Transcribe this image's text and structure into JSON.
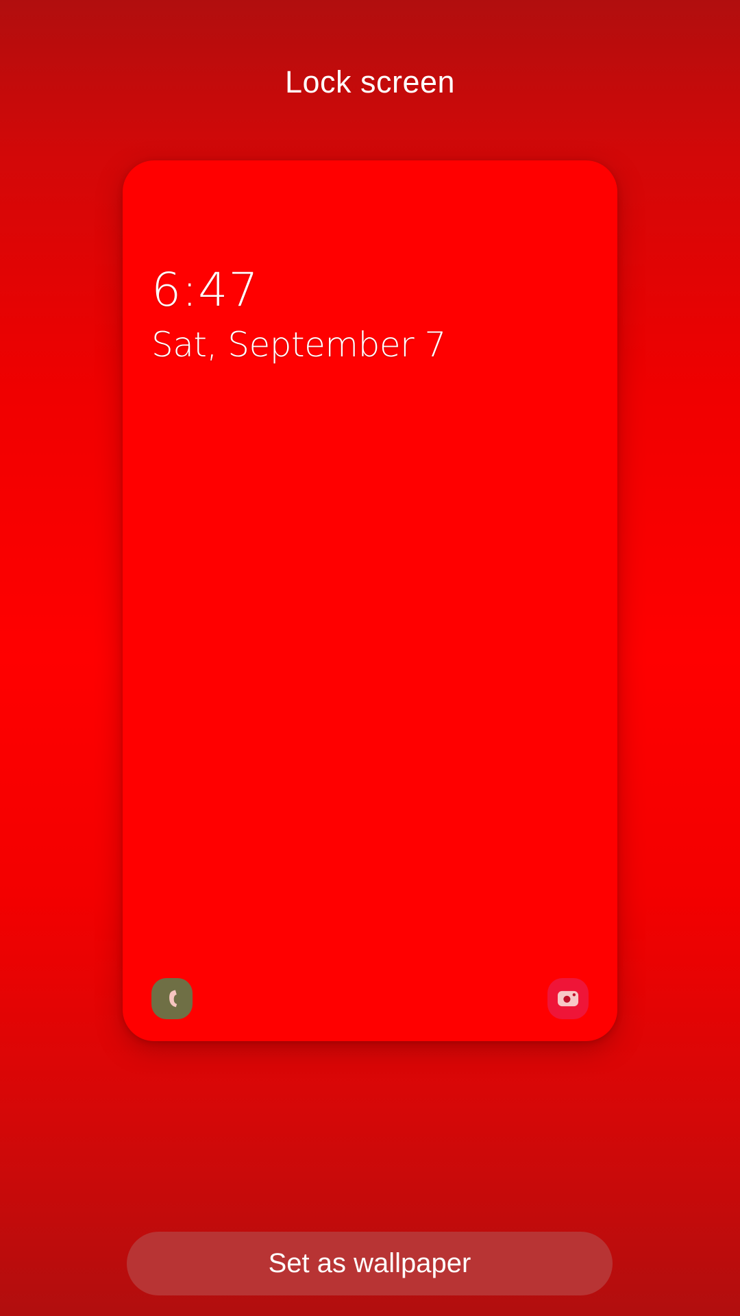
{
  "header": {
    "title": "Lock screen"
  },
  "preview": {
    "time": "6:47",
    "date": "Sat, September 7",
    "background_color": "#ff0000",
    "shortcuts": {
      "left": {
        "icon": "phone-icon",
        "color": "#6f6f45"
      },
      "right": {
        "icon": "camera-icon",
        "color": "#ef1538"
      }
    }
  },
  "actions": {
    "set_wallpaper_label": "Set as wallpaper"
  }
}
